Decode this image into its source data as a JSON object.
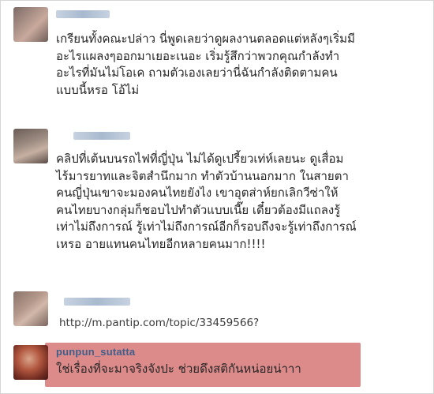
{
  "comments": [
    {
      "username": "",
      "lines": [
        "เกรียนทั้งคณะปล่าว นี่พูดเลยว่าดูผลงานตลอดแต่หลังๆเริ่มมี",
        "อะไรแผลงๆออกมาเยอะเนอะ เริ่มรู้สึกว่าพวกคุณกำลังทำ",
        "อะไรที่มันไม่โอเค ถามตัวเองเลยว่านี่ฉันกำลังติดตามคน",
        "แบบนี้หรอ โอ้ไม่"
      ]
    },
    {
      "username": "",
      "lines": [
        "คลิปที่เต้นบนรถไฟที่ญี่ปุ่น ไม่ได้ดูเปรี้ยวเท่ห์เลยนะ ดูเสื่อม",
        "ไร้มารยาทและจิตสำนึกมาก ทำตัวบ้านนอกมาก ในสายตา",
        "คนญี่ปุ่นเขาจะมองคนไทยยังไง เขาอุตส่าห์ยกเลิกวีซ่าให้",
        "คนไทยบางกลุ่มก็ชอบไปทำตัวแบบเนี๊ย เดี๋ยวต้องมีแถลงรู้",
        "เท่าไม่ถึงการณ์ รู้เท่าไม่ถึงการณ์อีกก็รอบถึงจะรู้เท่าถึงการณ์",
        "เหรอ อายแทนคนไทยอีกหลายคนมาก!!!!"
      ]
    },
    {
      "username": "",
      "lines": [
        "http://m.pantip.com/topic/33459566?"
      ]
    },
    {
      "username": "punpun_sutatta",
      "lines": [
        "ใช่เรื่องที่จะมาจริงจังปะ ช่วยดึงสติกันหน่อยน่าาา"
      ]
    }
  ],
  "colors": {
    "username": "#3f5f8a",
    "text": "#262626",
    "highlight": "#dc8a8a"
  }
}
